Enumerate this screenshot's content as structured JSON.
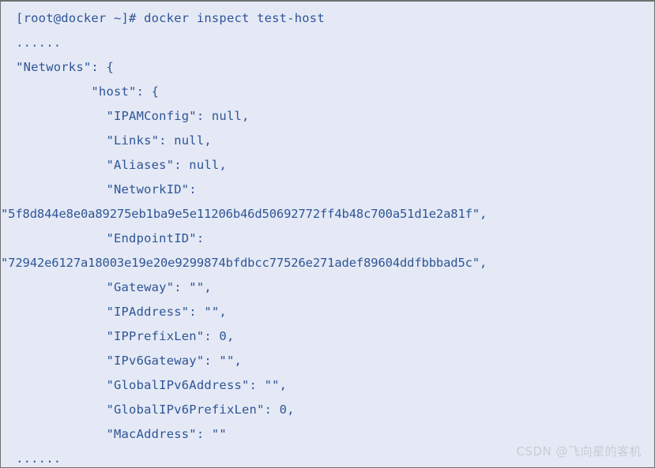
{
  "terminal": {
    "background_color": "#e4e9f5",
    "text_color": "#2f5597",
    "border_color": "#6f6f6f",
    "prompt": "[root@docker ~]#",
    "command": "docker inspect test-host",
    "lines": [
      {
        "id": "prompt-line",
        "indent": 2,
        "text": "[root@docker ~]# docker inspect test-host"
      },
      {
        "id": "ellipsis-top",
        "indent": 2,
        "text": "......"
      },
      {
        "id": "networks-key",
        "indent": 2,
        "text": "\"Networks\": {"
      },
      {
        "id": "host-key",
        "indent": 12,
        "text": "\"host\": {"
      },
      {
        "id": "ipamconfig-line",
        "indent": 14,
        "text": "\"IPAMConfig\": null,"
      },
      {
        "id": "links-line",
        "indent": 14,
        "text": "\"Links\": null,"
      },
      {
        "id": "aliases-line",
        "indent": 14,
        "text": "\"Aliases\": null,"
      },
      {
        "id": "networkid-key",
        "indent": 14,
        "text": "\"NetworkID\":"
      },
      {
        "id": "networkid-value",
        "indent": 0,
        "hash": true,
        "text": "\"5f8d844e8e0a89275eb1ba9e5e11206b46d50692772ff4b48c700a51d1e2a81f\","
      },
      {
        "id": "endpointid-key",
        "indent": 14,
        "text": "\"EndpointID\":"
      },
      {
        "id": "endpointid-value",
        "indent": 0,
        "hash": true,
        "text": "\"72942e6127a18003e19e20e9299874bfdbcc77526e271adef89604ddfbbbad5c\","
      },
      {
        "id": "gateway-line",
        "indent": 14,
        "text": "\"Gateway\": \"\","
      },
      {
        "id": "ipaddress-line",
        "indent": 14,
        "text": "\"IPAddress\": \"\","
      },
      {
        "id": "ipprefixlen-line",
        "indent": 14,
        "text": "\"IPPrefixLen\": 0,"
      },
      {
        "id": "ipv6gateway-line",
        "indent": 14,
        "text": "\"IPv6Gateway\": \"\","
      },
      {
        "id": "globalipv6address-line",
        "indent": 14,
        "text": "\"GlobalIPv6Address\": \"\","
      },
      {
        "id": "globalipv6prefixlen-line",
        "indent": 14,
        "text": "\"GlobalIPv6PrefixLen\": 0,"
      },
      {
        "id": "macaddress-line",
        "indent": 14,
        "text": "\"MacAddress\": \"\""
      },
      {
        "id": "ellipsis-bottom",
        "indent": 2,
        "text": "......"
      }
    ]
  },
  "watermark": {
    "text": "CSDN @飞向星的客机",
    "color": "#c9cbd2"
  }
}
